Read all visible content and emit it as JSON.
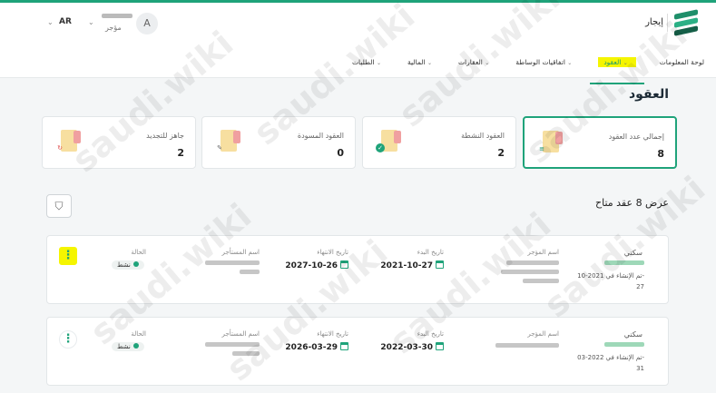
{
  "header": {
    "brand": "إيجار",
    "avatar_letter": "A",
    "user_role": "مؤجر",
    "language": "AR"
  },
  "nav": [
    {
      "label": "لوحة المعلومات",
      "caret": false,
      "active": false
    },
    {
      "label": "العقود",
      "caret": true,
      "active": true
    },
    {
      "label": "اتفاقيات الوساطة",
      "caret": true,
      "active": false
    },
    {
      "label": "العقارات",
      "caret": true,
      "active": false
    },
    {
      "label": "المالية",
      "caret": true,
      "active": false
    },
    {
      "label": "الطلبات",
      "caret": true,
      "active": false
    }
  ],
  "page_title": "العقود",
  "stats": [
    {
      "label": "إجمالي عدد العقود",
      "value": "8",
      "icon": "list-badge-icon",
      "color": "#1fa37a"
    },
    {
      "label": "العقود النشطة",
      "value": "2",
      "icon": "check-badge-icon",
      "color": "#1fa37a"
    },
    {
      "label": "العقود المسودة",
      "value": "0",
      "icon": "pencil-icon",
      "color": "#666666"
    },
    {
      "label": "جاهز للتجديد",
      "value": "2",
      "icon": "renew-icon",
      "color": "#e04b4b"
    }
  ],
  "list_title": "عرض 8 عقد متاح",
  "columns": {
    "lessor": "اسم المؤجر",
    "start": "تاريخ البدء",
    "end": "تاريخ الانتهاء",
    "tenant": "اسم المستأجر",
    "status": "الحالة"
  },
  "contracts": [
    {
      "type": "سكني",
      "created_line1": "تم الإنشاء في 2021-10-",
      "created_line2": "27",
      "start": "2021-10-27",
      "end": "2027-10-26",
      "status": "نشط"
    },
    {
      "type": "سكني",
      "created_line1": "تم الإنشاء في 2022-03-",
      "created_line2": "31",
      "start": "2022-03-30",
      "end": "2026-03-29",
      "status": "نشط"
    }
  ],
  "watermark": "saudi.wiki"
}
